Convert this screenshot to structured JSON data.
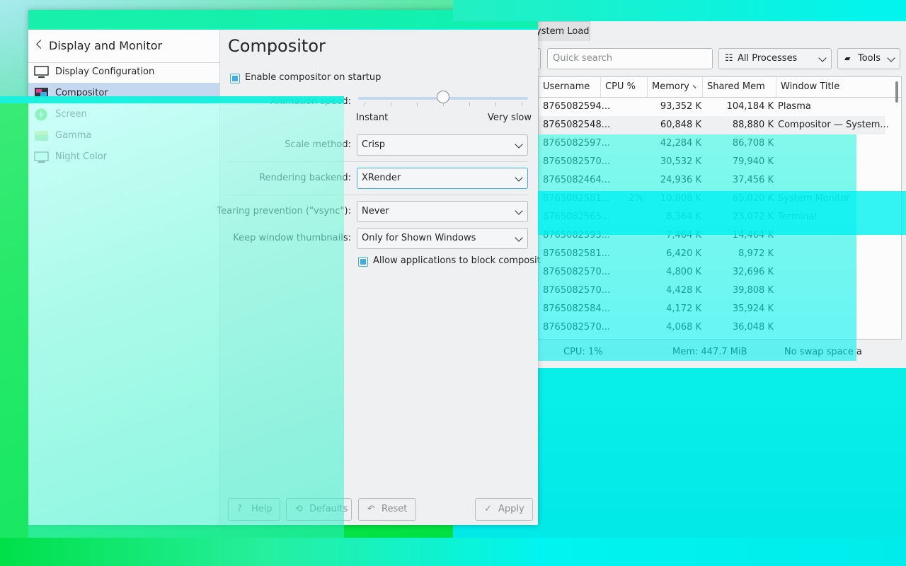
{
  "sysmon": {
    "tab_label": "ystem Load",
    "search_placeholder": "Quick search",
    "process_filter": "All Processes",
    "tools_label": "Tools",
    "columns": [
      "Username",
      "CPU %",
      "Memory",
      "Shared Mem",
      "Window Title"
    ],
    "rows": [
      {
        "user": "8765082594...",
        "cpu": "",
        "mem": "93,352 K",
        "shared": "104,184 K",
        "title": "Plasma"
      },
      {
        "user": "8765082548...",
        "cpu": "",
        "mem": "60,848 K",
        "shared": "88,880 K",
        "title": "Compositor  — System..."
      },
      {
        "user": "8765082597...",
        "cpu": "",
        "mem": "42,284 K",
        "shared": "86,708 K",
        "title": ""
      },
      {
        "user": "8765082570...",
        "cpu": "",
        "mem": "30,532 K",
        "shared": "79,940 K",
        "title": ""
      },
      {
        "user": "8765082464...",
        "cpu": "",
        "mem": "24,936 K",
        "shared": "37,456 K",
        "title": ""
      },
      {
        "user": "8765082581...",
        "cpu": "2%",
        "mem": "10,808 K",
        "shared": "65,020 K",
        "title": "System Monitor"
      },
      {
        "user": "8765082565...",
        "cpu": "",
        "mem": "8,364 K",
        "shared": "23,072 K",
        "title": "Terminal"
      },
      {
        "user": "8765082593...",
        "cpu": "",
        "mem": "7,464 K",
        "shared": "14,464 K",
        "title": ""
      },
      {
        "user": "8765082581...",
        "cpu": "",
        "mem": "6,420 K",
        "shared": "8,972 K",
        "title": ""
      },
      {
        "user": "8765082570...",
        "cpu": "",
        "mem": "4,800 K",
        "shared": "32,696 K",
        "title": ""
      },
      {
        "user": "8765082570...",
        "cpu": "",
        "mem": "4,428 K",
        "shared": "39,808 K",
        "title": ""
      },
      {
        "user": "8765082584...",
        "cpu": "",
        "mem": "4,172 K",
        "shared": "35,924 K",
        "title": ""
      },
      {
        "user": "8765082570...",
        "cpu": "",
        "mem": "4,068 K",
        "shared": "36,048 K",
        "title": ""
      }
    ],
    "status": {
      "cpu": "CPU: 1%",
      "mem": "Mem: 447.7 MiB",
      "swap": "No swap space a"
    }
  },
  "settings": {
    "sidebar": {
      "title": "Display and Monitor",
      "items": [
        {
          "label": "Display Configuration",
          "icon": "monitor-icon"
        },
        {
          "label": "Compositor",
          "icon": "compositor-icon"
        },
        {
          "label": "Screen",
          "icon": "power-icon"
        },
        {
          "label": "Gamma",
          "icon": "gamma-icon"
        },
        {
          "label": "Night Color",
          "icon": "night-color-icon"
        }
      ]
    },
    "page_title": "Compositor",
    "enable_on_startup": "Enable compositor on startup",
    "animation_speed_label": "Animation speed:",
    "animation_speed_value": 0.5,
    "slider_min_label": "Instant",
    "slider_max_label": "Very slow",
    "scale_method_label": "Scale method:",
    "scale_method_value": "Crisp",
    "rendering_backend_label": "Rendering backend:",
    "rendering_backend_value": "XRender",
    "tearing_label": "Tearing prevention (\"vsync\"):",
    "tearing_value": "Never",
    "thumbnails_label": "Keep window thumbnails:",
    "thumbnails_value": "Only for Shown Windows",
    "allow_block_label": "Allow applications to block composit",
    "buttons": {
      "help": "Help",
      "defaults": "Defaults",
      "reset": "Reset",
      "apply": "Apply"
    }
  },
  "colors": {
    "accent": "#3daee9",
    "selection": "#c4d9ef",
    "overlay_cyan": "#00f4f0",
    "overlay_green": "#12e84a"
  }
}
